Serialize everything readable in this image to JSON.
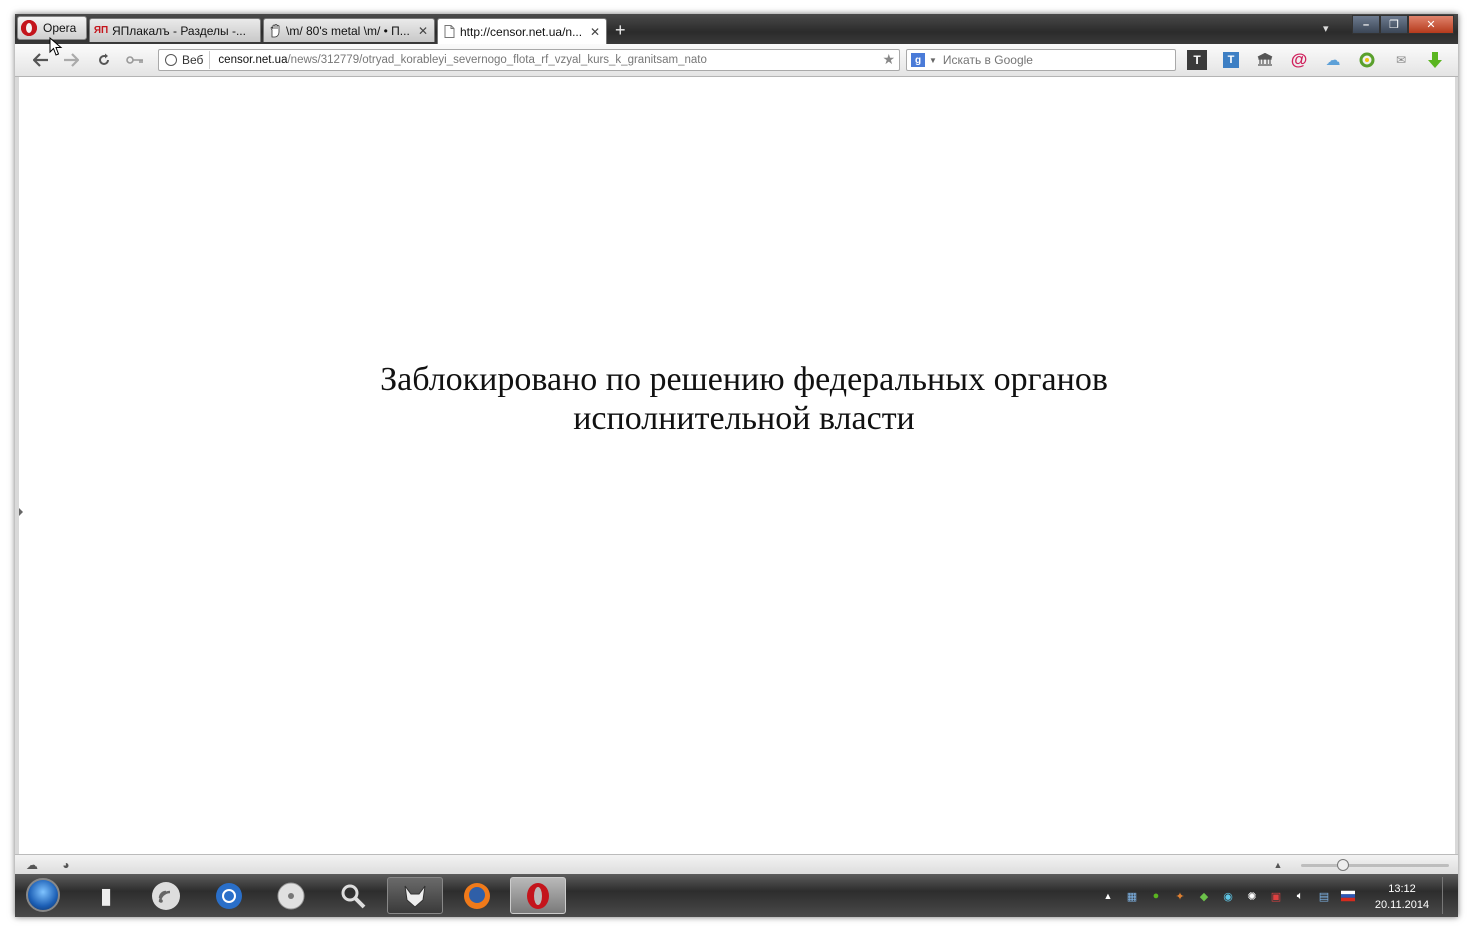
{
  "app": {
    "menu_button_label": "Opera"
  },
  "tabs": [
    {
      "favicon": "yaplakal-logo",
      "favicon_text": "ЯП",
      "title": "ЯПлакалъ - Разделы -...",
      "active": false
    },
    {
      "favicon": "hand-icon",
      "favicon_text": "",
      "title": "\\m/ 80's metal \\m/ • П...",
      "active": false
    },
    {
      "favicon": "page-icon",
      "favicon_text": "",
      "title": "http://censor.net.ua/n...",
      "active": true
    }
  ],
  "toolbar": {
    "address_badge": "Веб",
    "url_host": "censor.net.ua",
    "url_path": "/news/312779/otryad_korableyi_severnogo_flota_rf_vzyal_kurs_k_granitsam_nato",
    "search_engine_letter": "g",
    "search_placeholder": "Искать в Google"
  },
  "page": {
    "message_line1": "Заблокировано по решению федеральных органов",
    "message_line2": "исполнительной власти"
  },
  "taskbar": {
    "time": "13:12",
    "date": "20.11.2014"
  },
  "colors": {
    "opera_red": "#c4151c",
    "tab_bar_dark": "#2b2b2b",
    "page_background": "#ffffff",
    "text": "#111111"
  }
}
